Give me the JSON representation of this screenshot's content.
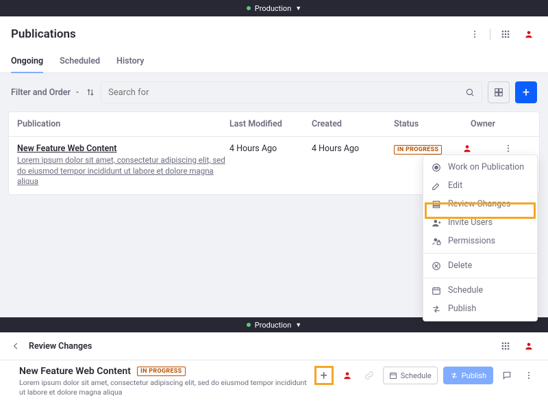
{
  "production_label": "Production",
  "page_title": "Publications",
  "tabs": [
    "Ongoing",
    "Scheduled",
    "History"
  ],
  "active_tab": 0,
  "filter_label": "Filter and Order",
  "search_placeholder": "Search for",
  "table": {
    "headers": [
      "Publication",
      "Last Modified",
      "Created",
      "Status",
      "Owner"
    ],
    "rows": [
      {
        "title": "New Feature Web Content",
        "desc": "Lorem ipsum dolor sit amet, consectetur adipiscing elit, sed do eiusmod tempor incididunt ut labore et dolore magna aliqua",
        "last_modified": "4 Hours Ago",
        "created": "4 Hours Ago",
        "status": "IN PROGRESS"
      }
    ]
  },
  "menu": {
    "work": "Work on Publication",
    "edit": "Edit",
    "review": "Review Changes",
    "invite": "Invite Users",
    "permissions": "Permissions",
    "delete": "Delete",
    "schedule": "Schedule",
    "publish": "Publish"
  },
  "review_header": "Review Changes",
  "detail": {
    "title": "New Feature Web Content",
    "status": "IN PROGRESS",
    "desc": "Lorem ipsum dolor sit amet, consectetur adipiscing elit, sed do eiusmod tempor incididunt ut labore et dolore magna aliqua",
    "schedule_btn": "Schedule",
    "publish_btn": "Publish"
  }
}
